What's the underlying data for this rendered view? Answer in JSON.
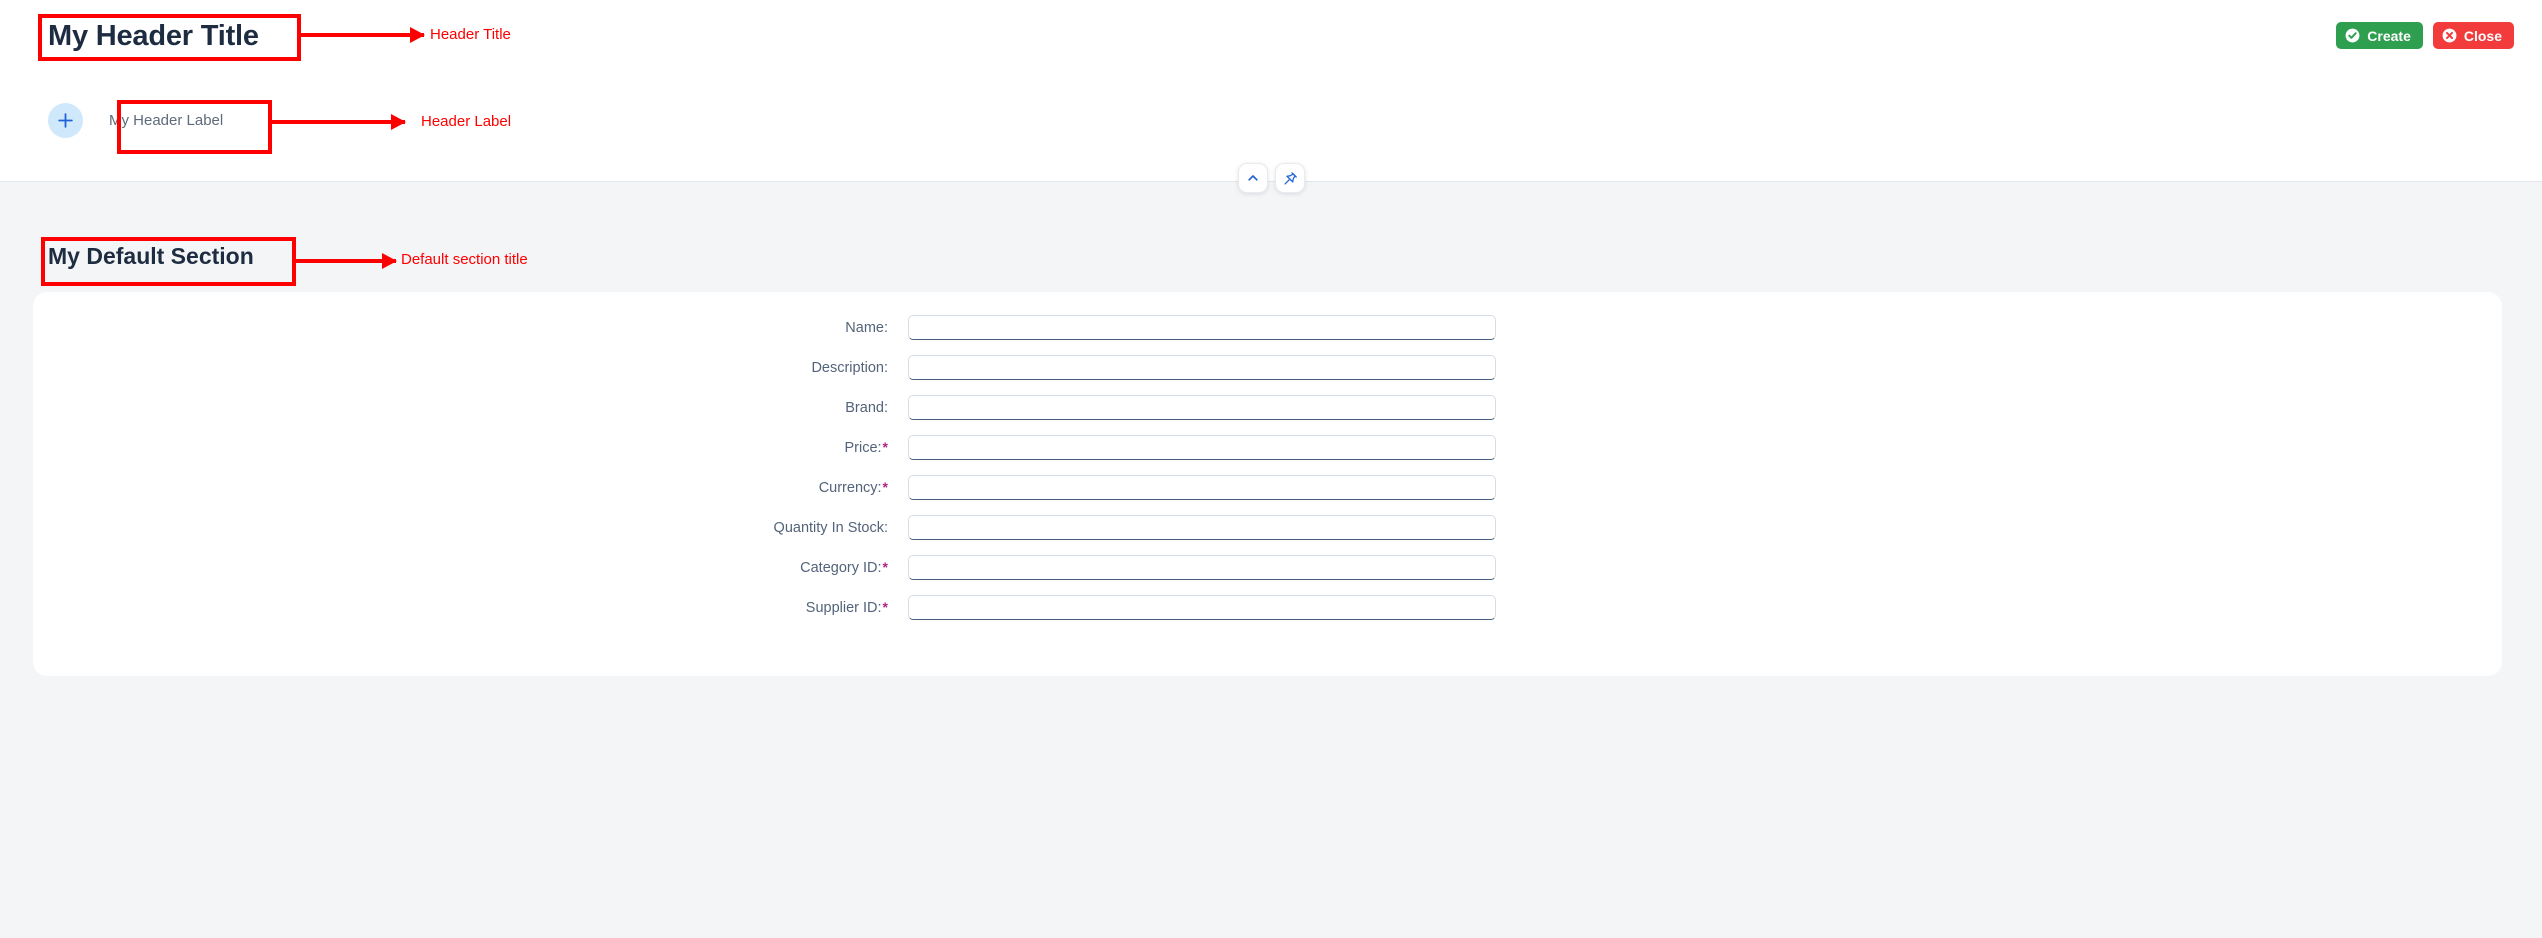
{
  "header": {
    "title": "My Header Title",
    "label": "My Header Label",
    "add_icon": "plus-icon",
    "collapse_icon": "chevron-up-icon",
    "pin_icon": "pin-icon",
    "buttons": [
      {
        "label": "Create",
        "icon": "check-circle-icon",
        "color": "#2e9e4f"
      },
      {
        "label": "Close",
        "icon": "x-circle-icon",
        "color": "#f23b3b"
      }
    ]
  },
  "section": {
    "title": "My Default Section",
    "fields": [
      {
        "label": "Name:",
        "required": false,
        "value": "",
        "placeholder": ""
      },
      {
        "label": "Description:",
        "required": false,
        "value": "",
        "placeholder": ""
      },
      {
        "label": "Brand:",
        "required": false,
        "value": "",
        "placeholder": ""
      },
      {
        "label": "Price:",
        "required": true,
        "value": "",
        "placeholder": ""
      },
      {
        "label": "Currency:",
        "required": true,
        "value": "",
        "placeholder": ""
      },
      {
        "label": "Quantity In Stock:",
        "required": false,
        "value": "",
        "placeholder": ""
      },
      {
        "label": "Category ID:",
        "required": true,
        "value": "",
        "placeholder": ""
      },
      {
        "label": "Supplier ID:",
        "required": true,
        "value": "",
        "placeholder": ""
      }
    ]
  },
  "annotations": [
    {
      "text": "Header Title"
    },
    {
      "text": "Header Label"
    },
    {
      "text": "Default section title"
    }
  ],
  "colors": {
    "annotation": "#ff0000",
    "required_star": "#b3248a",
    "accent_blue": "#1d62d6",
    "page_bg": "#f4f5f7",
    "card_bg": "#ffffff",
    "title_text": "#1d2c40"
  }
}
